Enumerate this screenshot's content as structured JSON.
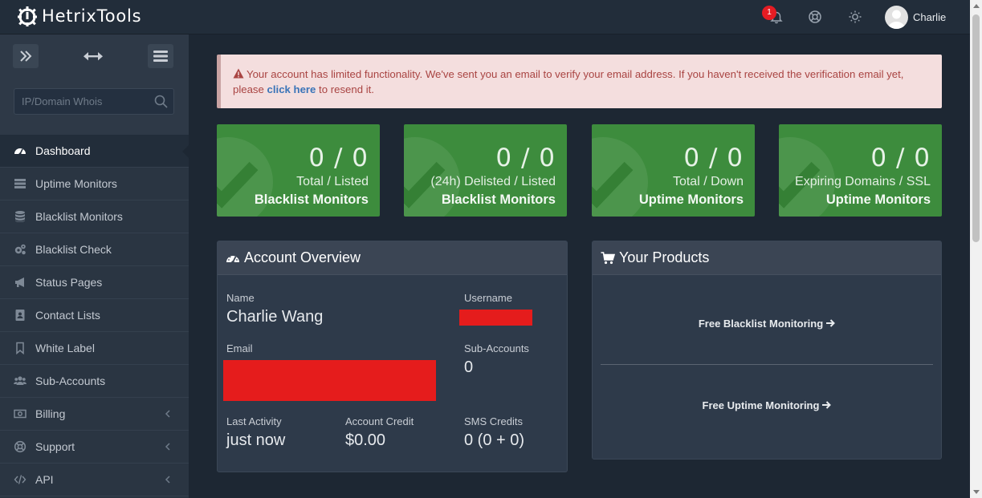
{
  "app": {
    "logo_text": "HetrixTools"
  },
  "topbar": {
    "notification_count": "1",
    "user_name": "Charlie"
  },
  "sidebar": {
    "whois_placeholder": "IP/Domain Whois",
    "items": [
      {
        "label": "Dashboard",
        "icon": "dashboard-icon",
        "active": true
      },
      {
        "label": "Uptime Monitors",
        "icon": "list-icon"
      },
      {
        "label": "Blacklist Monitors",
        "icon": "database-icon"
      },
      {
        "label": "Blacklist Check",
        "icon": "cogs-icon"
      },
      {
        "label": "Status Pages",
        "icon": "bullhorn-icon"
      },
      {
        "label": "Contact Lists",
        "icon": "contact-book-icon"
      },
      {
        "label": "White Label",
        "icon": "bookmark-icon"
      },
      {
        "label": "Sub-Accounts",
        "icon": "users-icon"
      },
      {
        "label": "Billing",
        "icon": "money-icon",
        "has_children": true
      },
      {
        "label": "Support",
        "icon": "life-ring-icon",
        "has_children": true
      },
      {
        "label": "API",
        "icon": "code-icon",
        "has_children": true
      }
    ]
  },
  "alert": {
    "text_before": "Your account has limited functionality. We've sent you an email to verify your email address. If you haven't received the verification email yet, please ",
    "link_text": "click here",
    "text_after": " to resend it."
  },
  "stats": [
    {
      "value": "0 / 0",
      "subtitle": "Total / Listed",
      "type": "Blacklist Monitors"
    },
    {
      "value": "0 / 0",
      "subtitle": "(24h) Delisted / Listed",
      "type": "Blacklist Monitors"
    },
    {
      "value": "0 / 0",
      "subtitle": "Total / Down",
      "type": "Uptime Monitors"
    },
    {
      "value": "0 / 0",
      "subtitle": "Expiring Domains / SSL",
      "type": "Uptime Monitors"
    }
  ],
  "account": {
    "title": "Account Overview",
    "name_label": "Name",
    "name_value": "Charlie Wang",
    "username_label": "Username",
    "email_label": "Email",
    "subaccounts_label": "Sub-Accounts",
    "subaccounts_value": "0",
    "last_activity_label": "Last Activity",
    "last_activity_value": "just now",
    "credit_label": "Account Credit",
    "credit_value": "$0.00",
    "sms_label": "SMS Credits",
    "sms_value": "0 (0 + 0)"
  },
  "products": {
    "title": "Your Products",
    "items": [
      "Free Blacklist Monitoring",
      "Free Uptime Monitoring"
    ]
  },
  "colors": {
    "stat_green": "#3d8c3d",
    "alert_bg": "#f4dede",
    "redaction": "#e51c1c",
    "badge": "#e51c23"
  }
}
